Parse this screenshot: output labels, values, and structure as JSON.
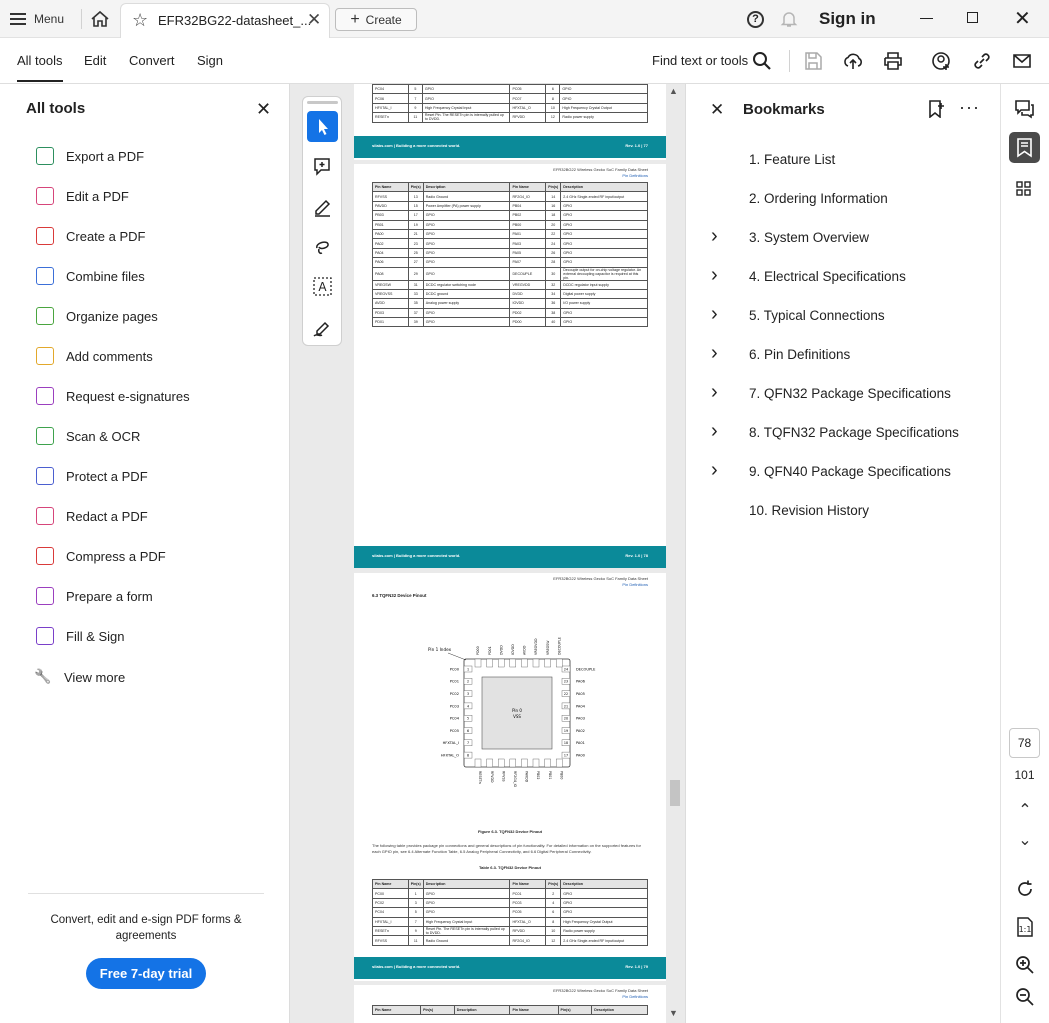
{
  "titlebar": {
    "menu_label": "Menu",
    "tab_title": "EFR32BG22-datasheet_...",
    "create_label": "Create",
    "signin_label": "Sign in"
  },
  "menubar": {
    "items": [
      "All tools",
      "Edit",
      "Convert",
      "Sign"
    ],
    "find_label": "Find text or tools"
  },
  "left_panel": {
    "title": "All tools",
    "tools": [
      {
        "label": "Export a PDF",
        "icon": "export-pdf-icon",
        "color": "#2d8f5f"
      },
      {
        "label": "Edit a PDF",
        "icon": "edit-pdf-icon",
        "color": "#d6457a"
      },
      {
        "label": "Create a PDF",
        "icon": "create-pdf-icon",
        "color": "#d93a3a"
      },
      {
        "label": "Combine files",
        "icon": "combine-files-icon",
        "color": "#3b6fd8"
      },
      {
        "label": "Organize pages",
        "icon": "organize-pages-icon",
        "color": "#4aa53f"
      },
      {
        "label": "Add comments",
        "icon": "add-comments-icon",
        "color": "#e2a82b"
      },
      {
        "label": "Request e-signatures",
        "icon": "request-esignatures-icon",
        "color": "#9b3fbf"
      },
      {
        "label": "Scan & OCR",
        "icon": "scan-ocr-icon",
        "color": "#3ea24d"
      },
      {
        "label": "Protect a PDF",
        "icon": "protect-pdf-icon",
        "color": "#4b5fd0"
      },
      {
        "label": "Redact a PDF",
        "icon": "redact-pdf-icon",
        "color": "#d6457a"
      },
      {
        "label": "Compress a PDF",
        "icon": "compress-pdf-icon",
        "color": "#d93a3a"
      },
      {
        "label": "Prepare a form",
        "icon": "prepare-form-icon",
        "color": "#9b3fbf"
      },
      {
        "label": "Fill & Sign",
        "icon": "fill-sign-icon",
        "color": "#7a3fc9"
      },
      {
        "label": "View more",
        "icon": "wrench-icon",
        "color": "#333333"
      }
    ],
    "promo_text": "Convert, edit and e-sign PDF forms & agreements",
    "trial_label": "Free 7-day trial"
  },
  "document": {
    "footer_left": "silabs.com | Building a more connected world.",
    "page_head_1": "EFR32BG22 Wireless Gecko SoC Family Data Sheet",
    "page_head_2": "Pin Definitions",
    "page77_footer": "Rev. 1.0 | 77",
    "page78_footer": "Rev. 1.0 | 78",
    "page79_footer": "Rev. 1.0 | 79",
    "top_rows": [
      [
        "PC04",
        "5",
        "GPIO",
        "PC05",
        "6",
        "GPIO"
      ],
      [
        "PC06",
        "7",
        "GPIO",
        "PC07",
        "8",
        "GPIO"
      ],
      [
        "HFXTAL_I",
        "9",
        "High Frequency Crystal Input",
        "HFXTAL_O",
        "10",
        "High Frequency Crystal Output"
      ],
      [
        "RESETn",
        "11",
        "Reset Pin. The RESETn pin is internally pulled up to DVDD.",
        "RFVDD",
        "12",
        "Radio power supply"
      ]
    ],
    "headers": [
      "Pin Name",
      "Pin(s)",
      "Description",
      "Pin Name",
      "Pin(s)",
      "Description"
    ],
    "page78_rows": [
      [
        "RFVSS",
        "13",
        "Radio Ground",
        "RF2G4_IO",
        "14",
        "2.4 GHz Single-ended RF input/output"
      ],
      [
        "PAVDD",
        "15",
        "Power Amplifier (PA) power supply",
        "PB04",
        "16",
        "GPIO"
      ],
      [
        "PB03",
        "17",
        "GPIO",
        "PB02",
        "18",
        "GPIO"
      ],
      [
        "PB01",
        "19",
        "GPIO",
        "PB00",
        "20",
        "GPIO"
      ],
      [
        "PA00",
        "21",
        "GPIO",
        "PA01",
        "22",
        "GPIO"
      ],
      [
        "PA02",
        "23",
        "GPIO",
        "PA03",
        "24",
        "GPIO"
      ],
      [
        "PA04",
        "25",
        "GPIO",
        "PA05",
        "26",
        "GPIO"
      ],
      [
        "PA06",
        "27",
        "GPIO",
        "PA07",
        "28",
        "GPIO"
      ],
      [
        "PA08",
        "29",
        "GPIO",
        "DECOUPLE",
        "30",
        "Decouple output for on-chip voltage regulator. An external decoupling capacitor is required at this pin."
      ],
      [
        "VREGSW",
        "31",
        "DCDC regulator switching node",
        "VREGVDD",
        "32",
        "DCDC regulator input supply"
      ],
      [
        "VREGVSS",
        "33",
        "DCDC ground",
        "DVDD",
        "34",
        "Digital power supply"
      ],
      [
        "AVDD",
        "35",
        "Analog power supply",
        "IOVDD",
        "36",
        "I/O power supply"
      ],
      [
        "PD03",
        "37",
        "GPIO",
        "PD02",
        "38",
        "GPIO"
      ],
      [
        "PD01",
        "39",
        "GPIO",
        "PD00",
        "40",
        "GPIO"
      ]
    ],
    "section_title": "6.3 TQFN32 Device Pinout",
    "pin1_label": "Pin 1 Index",
    "center_pad_label": "Pin 0",
    "center_pad_sub": "VSS",
    "figure_title": "Figure 6.3. TQFN32 Device Pinout",
    "paragraph": "The following table provides package pin connections and general descriptions of pin functionality. For detailed information on the supported features for each GPIO pin, see 6.4 Alternate Function Table, 6.5 Analog Peripheral Connectivity, and 6.6 Digital Peripheral Connectivity.",
    "table_title": "Table 6.3. TQFN32 Device Pinout",
    "page79_rows": [
      [
        "PC00",
        "1",
        "GPIO",
        "PC01",
        "2",
        "GPIO"
      ],
      [
        "PC02",
        "3",
        "GPIO",
        "PC03",
        "4",
        "GPIO"
      ],
      [
        "PC04",
        "5",
        "GPIO",
        "PC05",
        "6",
        "GPIO"
      ],
      [
        "HFXTAL_I",
        "7",
        "High Frequency Crystal Input",
        "HFXTAL_O",
        "8",
        "High Frequency Crystal Output"
      ],
      [
        "RESETn",
        "9",
        "Reset Pin. The RESETn pin is internally pulled up to DVDD.",
        "RFVDD",
        "10",
        "Radio power supply"
      ],
      [
        "RFVSS",
        "11",
        "Radio Ground",
        "RF2G4_IO",
        "12",
        "2.4 GHz Single-ended RF input/output"
      ]
    ],
    "left_pins": [
      "PC00",
      "PC01",
      "PC02",
      "PC03",
      "PC04",
      "PC05",
      "HFXTAL_I",
      "HFXTAL_O"
    ],
    "right_pins": [
      "DECOUPLE",
      "PA06",
      "PA05",
      "PA04",
      "PA03",
      "PA02",
      "PA01",
      "PA00"
    ],
    "top_pins": [
      "PD00",
      "PD01",
      "DVDD",
      "IOVDD",
      "AVDD",
      "VREGVDD",
      "VREGSW",
      "DECOUPLE"
    ],
    "bottom_pins": [
      "RESETn",
      "RFVDD",
      "RFVSS",
      "RF2G4_IO",
      "PAVDD",
      "PB02",
      "PB01",
      "PB00"
    ]
  },
  "bookmarks": {
    "title": "Bookmarks",
    "more_label": "···",
    "items": [
      {
        "label": "1. Feature List",
        "expandable": false
      },
      {
        "label": "2. Ordering Information",
        "expandable": false
      },
      {
        "label": "3. System Overview",
        "expandable": true
      },
      {
        "label": "4. Electrical Specifications",
        "expandable": true
      },
      {
        "label": "5. Typical Connections",
        "expandable": true
      },
      {
        "label": "6. Pin Definitions",
        "expandable": true
      },
      {
        "label": "7. QFN32 Package Specifications",
        "expandable": true
      },
      {
        "label": "8. TQFN32 Package Specifications",
        "expandable": true
      },
      {
        "label": "9. QFN40 Package Specifications",
        "expandable": true
      },
      {
        "label": "10. Revision History",
        "expandable": false
      }
    ]
  },
  "rail": {
    "current_page": "78",
    "total_pages": "101"
  },
  "colors": {
    "accent": "#1473e6",
    "teal_footer": "#0b8a99"
  }
}
